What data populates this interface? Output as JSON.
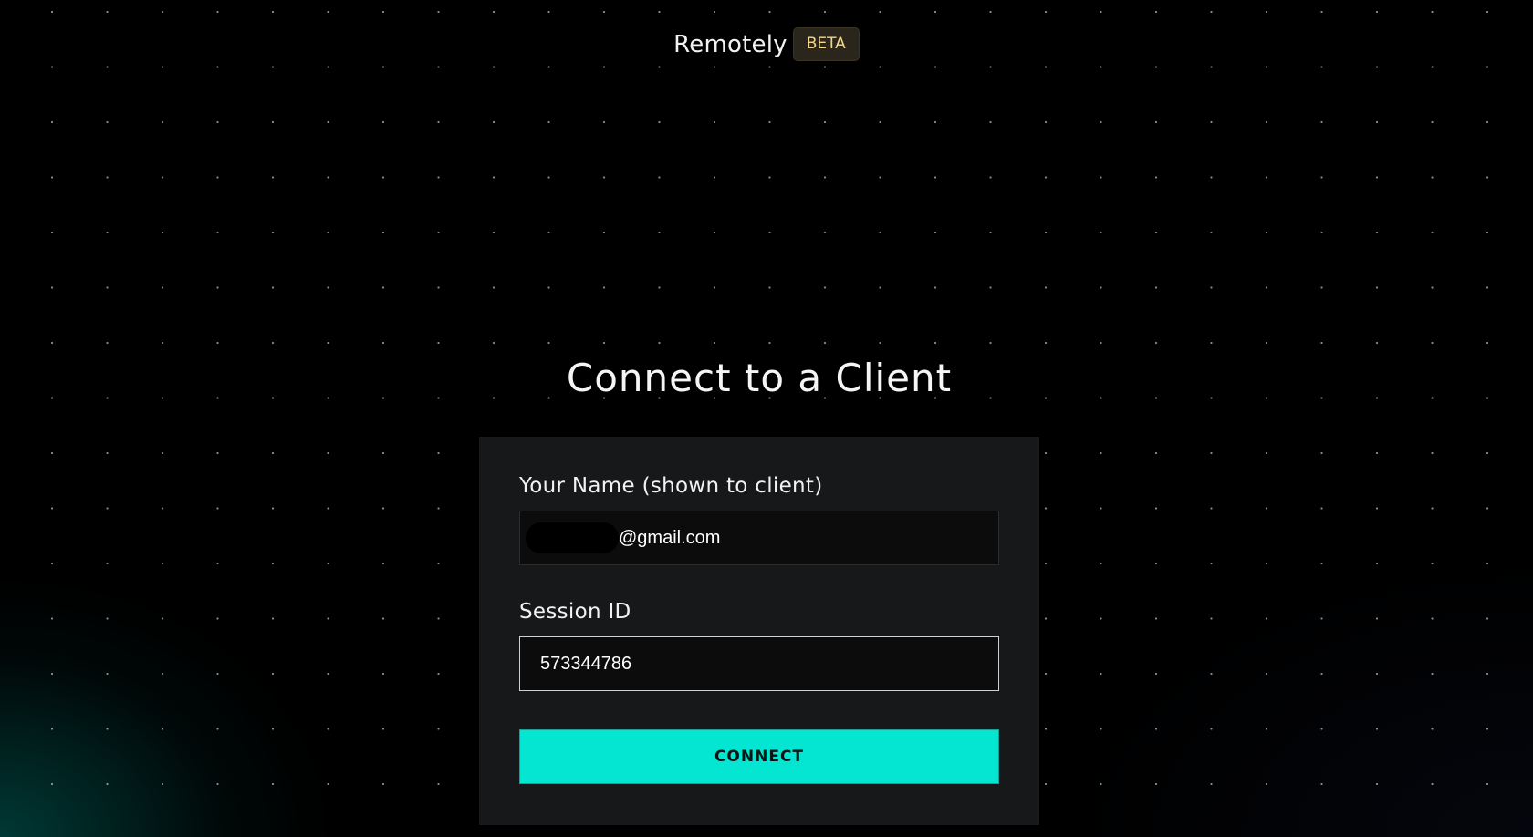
{
  "header": {
    "brand_name": "Remotely",
    "badge": "BETA"
  },
  "main": {
    "title": "Connect to a Client",
    "form": {
      "name_label": "Your Name (shown to client)",
      "name_value_visible": "@gmail.com",
      "session_label": "Session ID",
      "session_value": "573344786",
      "connect_label": "CONNECT"
    }
  },
  "colors": {
    "background": "#000000",
    "card": "#17181a",
    "accent": "#04e5d2",
    "badge_text": "#f6d68a"
  }
}
